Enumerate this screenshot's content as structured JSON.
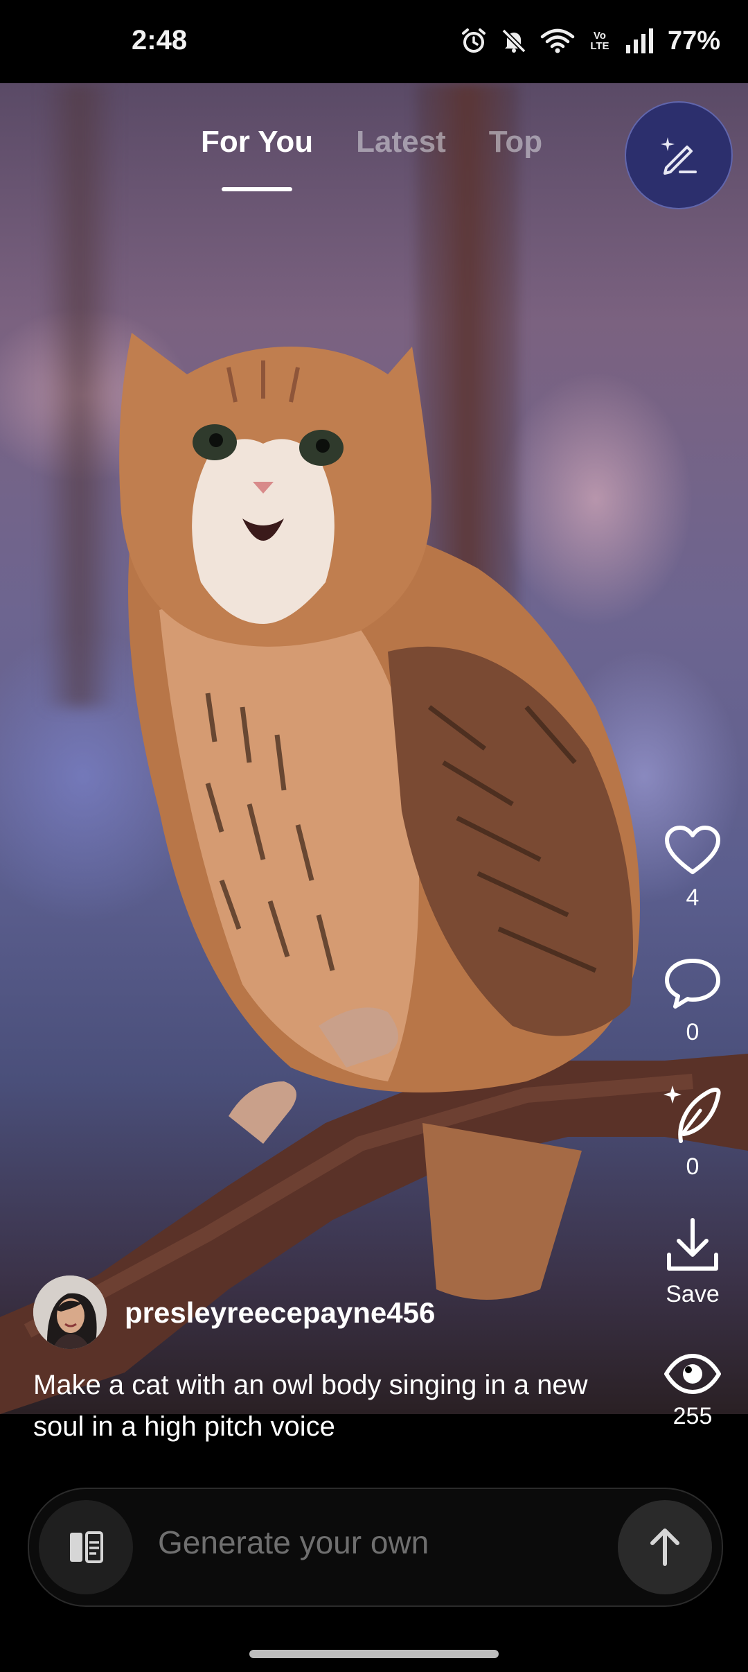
{
  "status_bar": {
    "time": "2:48",
    "network_label": "Vo LTE",
    "battery": "77%",
    "icons": [
      "alarm-icon",
      "bell-muted-icon",
      "wifi-icon",
      "volte-icon",
      "signal-icon"
    ]
  },
  "tabs": [
    {
      "label": "For You",
      "active": true
    },
    {
      "label": "Latest",
      "active": false
    },
    {
      "label": "Top",
      "active": false
    }
  ],
  "actions": {
    "likes": "4",
    "comments": "0",
    "remixes": "0",
    "save_label": "Save",
    "views": "255"
  },
  "post": {
    "username": "presleyreecepayne456",
    "caption": "Make a cat with an owl body singing in a new soul in a high pitch voice"
  },
  "composer": {
    "placeholder": "Generate your own"
  },
  "colors": {
    "create_button": "#2c2f6d",
    "input_background": "#0b0b0b"
  }
}
